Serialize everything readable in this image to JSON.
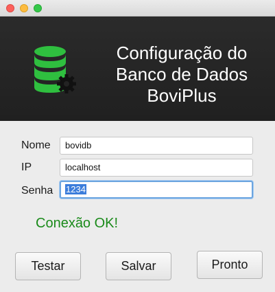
{
  "window": {
    "controls": [
      "close",
      "minimize",
      "maximize"
    ]
  },
  "header": {
    "title_lines": [
      "Configuração do",
      "Banco de Dados",
      "BoviPlus"
    ],
    "icon": "database-gear-icon",
    "icon_color": "#2fbf3f",
    "background": "#232323"
  },
  "form": {
    "nome": {
      "label": "Nome",
      "value": "bovidb"
    },
    "ip": {
      "label": "IP",
      "value": "localhost"
    },
    "senha": {
      "label": "Senha",
      "value": "1234",
      "selected": true
    }
  },
  "status": {
    "text": "Conexão OK!",
    "color": "#1a8a1a"
  },
  "buttons": {
    "testar": "Testar",
    "salvar": "Salvar",
    "pronto": "Pronto"
  }
}
